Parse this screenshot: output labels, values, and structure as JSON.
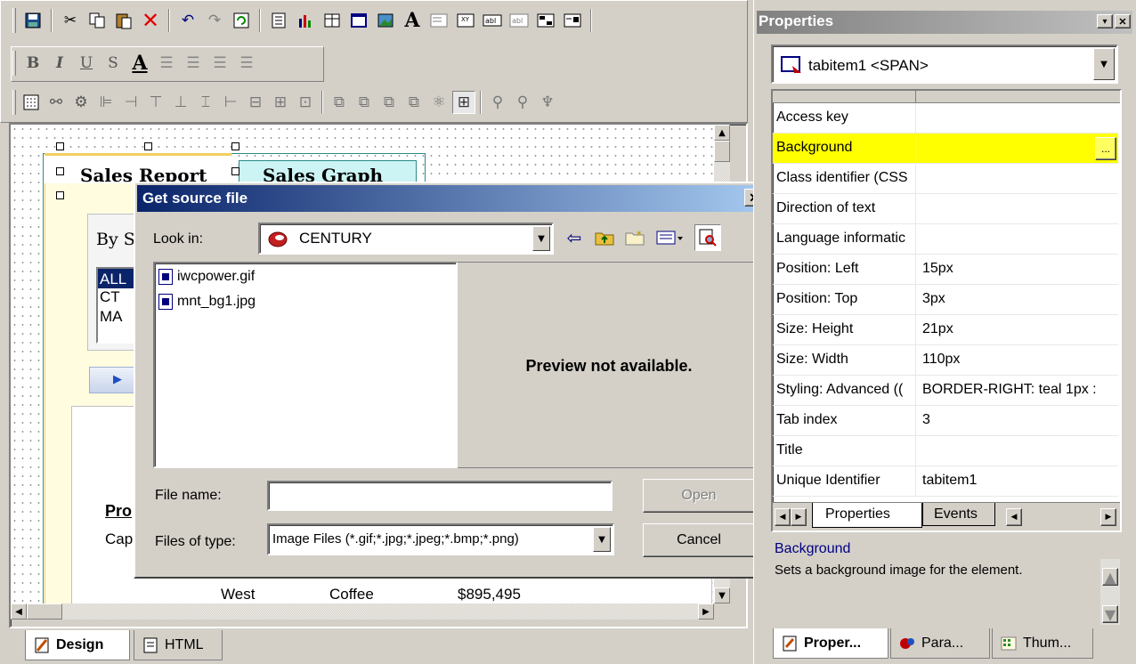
{
  "toolbar": {
    "row1_icons": [
      "save-icon",
      "cut-icon",
      "copy-icon",
      "paste-icon",
      "delete-icon",
      "undo-icon",
      "redo-icon",
      "refresh-icon",
      "report-icon",
      "chart-icon",
      "grid-icon",
      "frame-icon",
      "image-icon",
      "text-icon",
      "listbox-icon",
      "xy-icon",
      "textbox-icon",
      "textarea-icon",
      "form-icon",
      "form2-icon"
    ],
    "format_bold": "B",
    "format_italic": "I",
    "format_underline": "U",
    "format_strike": "S",
    "format_color": "A"
  },
  "designer": {
    "tab_sales_report": "Sales Report",
    "tab_sales_graph": "Sales Graph",
    "by_label": "By S",
    "list_items": [
      "ALL",
      "CT",
      "MA"
    ],
    "run_arrow": "▶",
    "pro_label": "Pro",
    "cap_label": "Cap",
    "table_row": {
      "region": "West",
      "product": "Coffee",
      "amount": "$895,495"
    }
  },
  "bottom_tabs": {
    "design": "Design",
    "html": "HTML"
  },
  "dialog": {
    "title": "Get source file",
    "close": "✕",
    "look_in_label": "Look in:",
    "look_in_value": "CENTURY",
    "files": [
      "iwcpower.gif",
      "mnt_bg1.jpg"
    ],
    "preview_text": "Preview not available.",
    "file_name_label": "File name:",
    "file_name_value": "",
    "files_of_type_label": "Files of type:",
    "files_of_type_value": "Image Files (*.gif;*.jpg;*.jpeg;*.bmp;*.png)",
    "open_button": "Open",
    "cancel_button": "Cancel"
  },
  "properties": {
    "title": "Properties",
    "selector": "tabitem1 <SPAN>",
    "rows": [
      {
        "key": "Access key",
        "value": ""
      },
      {
        "key": "Background",
        "value": ""
      },
      {
        "key": "Class identifier (CSS",
        "value": ""
      },
      {
        "key": "Direction of text",
        "value": ""
      },
      {
        "key": "Language informatic",
        "value": ""
      },
      {
        "key": "Position: Left",
        "value": "15px"
      },
      {
        "key": "Position: Top",
        "value": "3px"
      },
      {
        "key": "Size: Height",
        "value": "21px"
      },
      {
        "key": "Size: Width",
        "value": "110px"
      },
      {
        "key": "Styling: Advanced ((",
        "value": "BORDER-RIGHT: teal 1px :"
      },
      {
        "key": "Tab index",
        "value": "3"
      },
      {
        "key": "Title",
        "value": ""
      },
      {
        "key": "Unique Identifier",
        "value": "tabitem1"
      }
    ],
    "selected_row": "Background",
    "ellipsis": "...",
    "tab_properties": "Properties",
    "tab_events": "Events",
    "desc_title": "Background",
    "desc_text": "Sets a background image for the element.",
    "bottom_tabs": [
      "Proper...",
      "Para...",
      "Thum..."
    ],
    "highlight_color": "#ffff00",
    "title_gradient_start": "#808080",
    "title_gradient_end": "#c0c0c0"
  },
  "colors": {
    "dialog_title_start": "#0a246a",
    "dialog_title_end": "#a6caf0",
    "tab_gold": "#f0d060",
    "tab_teal": "#ccf4f4"
  }
}
